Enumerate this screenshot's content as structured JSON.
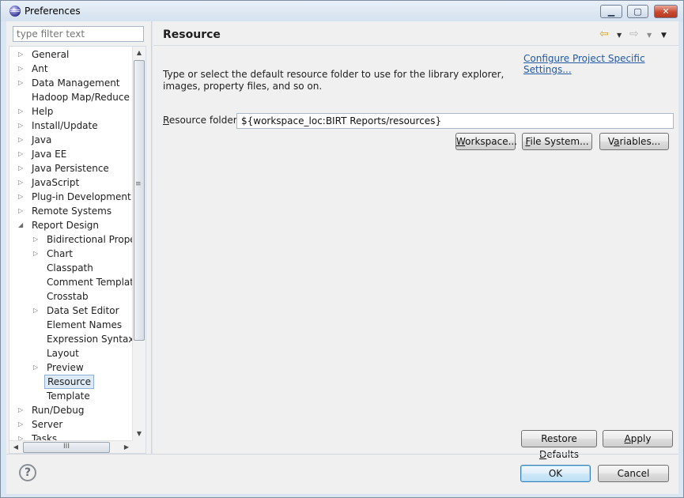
{
  "window": {
    "title": "Preferences",
    "icon": "eclipse-icon",
    "controls": {
      "minimize": "▁",
      "maximize": "▢",
      "close": "✕"
    }
  },
  "sidebar": {
    "filter_placeholder": "type filter text",
    "tree": [
      {
        "label": "General",
        "arrow": "▷",
        "level": 0
      },
      {
        "label": "Ant",
        "arrow": "▷",
        "level": 0
      },
      {
        "label": "Data Management",
        "arrow": "▷",
        "level": 0
      },
      {
        "label": "Hadoop Map/Reduce",
        "arrow": "",
        "level": 0
      },
      {
        "label": "Help",
        "arrow": "▷",
        "level": 0
      },
      {
        "label": "Install/Update",
        "arrow": "▷",
        "level": 0
      },
      {
        "label": "Java",
        "arrow": "▷",
        "level": 0
      },
      {
        "label": "Java EE",
        "arrow": "▷",
        "level": 0
      },
      {
        "label": "Java Persistence",
        "arrow": "▷",
        "level": 0
      },
      {
        "label": "JavaScript",
        "arrow": "▷",
        "level": 0
      },
      {
        "label": "Plug-in Development",
        "arrow": "▷",
        "level": 0
      },
      {
        "label": "Remote Systems",
        "arrow": "▷",
        "level": 0
      },
      {
        "label": "Report Design",
        "arrow": "◢",
        "level": 0
      },
      {
        "label": "Bidirectional Propert",
        "arrow": "▷",
        "level": 1
      },
      {
        "label": "Chart",
        "arrow": "▷",
        "level": 1
      },
      {
        "label": "Classpath",
        "arrow": "",
        "level": 1
      },
      {
        "label": "Comment Template",
        "arrow": "",
        "level": 1
      },
      {
        "label": "Crosstab",
        "arrow": "",
        "level": 1
      },
      {
        "label": "Data Set Editor",
        "arrow": "▷",
        "level": 1
      },
      {
        "label": "Element Names",
        "arrow": "",
        "level": 1
      },
      {
        "label": "Expression Syntax",
        "arrow": "",
        "level": 1
      },
      {
        "label": "Layout",
        "arrow": "",
        "level": 1
      },
      {
        "label": "Preview",
        "arrow": "▷",
        "level": 1
      },
      {
        "label": "Resource",
        "arrow": "",
        "level": 1,
        "selected": true
      },
      {
        "label": "Template",
        "arrow": "",
        "level": 1
      },
      {
        "label": "Run/Debug",
        "arrow": "▷",
        "level": 0
      },
      {
        "label": "Server",
        "arrow": "▷",
        "level": 0
      },
      {
        "label": "Tasks",
        "arrow": "▷",
        "level": 0
      }
    ],
    "scroll": {
      "up": "▲",
      "down": "▼",
      "left": "◀",
      "right": "▶",
      "grip_v": "≡",
      "grip_h": "III"
    }
  },
  "page": {
    "title": "Resource",
    "nav": {
      "back": "⇦",
      "dropdown": "▼",
      "forward": "⇨",
      "menu": "▼"
    },
    "config_link": "Configure Project Specific Settings...",
    "description": "Type or select the default resource folder to use for the library explorer, images, property files, and so on.",
    "resource_folder": {
      "label_mnemonic": "R",
      "label_rest": "esource folder",
      "value": "${workspace_loc:BIRT Reports/resources}"
    },
    "buttons": {
      "workspace": {
        "mnemonic": "W",
        "rest": "orkspace..."
      },
      "filesystem": {
        "mnemonic": "F",
        "rest": "ile System..."
      },
      "variables": {
        "pre": "V",
        "mnemonic": "a",
        "rest": "riables..."
      },
      "restore": {
        "pre": "Restore ",
        "mnemonic": "D",
        "rest": "efaults"
      },
      "apply": {
        "mnemonic": "A",
        "rest": "pply"
      }
    }
  },
  "dialog": {
    "help": "?",
    "ok": "OK",
    "cancel": "Cancel"
  },
  "colors": {
    "link": "#2359a6",
    "selection": "#dfeaf7",
    "titlebar": "#d4e1ef",
    "back_arrow": "#d9a21b"
  }
}
